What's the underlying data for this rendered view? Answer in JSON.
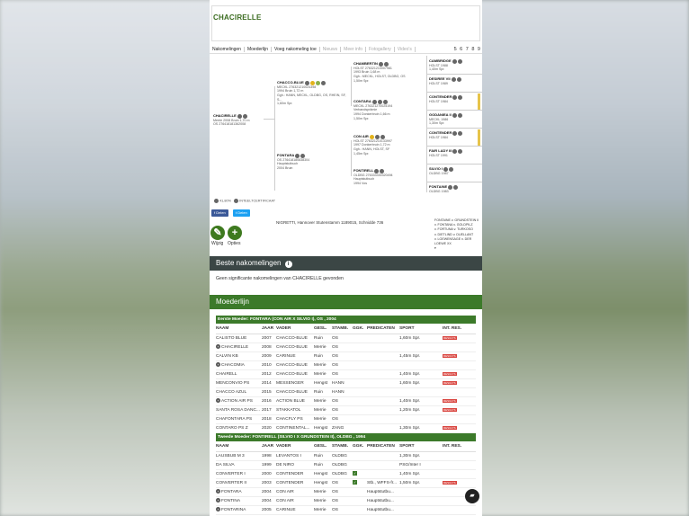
{
  "page": {
    "title": "CHACIRELLE"
  },
  "tabs": [
    {
      "label": "Nakomelingen",
      "muted": false
    },
    {
      "label": "Moederlijn",
      "muted": false
    },
    {
      "label": "Voeg nakomeling toe",
      "muted": false
    },
    {
      "label": "Nieuws",
      "muted": true
    },
    {
      "label": "Meer info",
      "muted": true
    },
    {
      "label": "Fotogallery",
      "muted": true
    },
    {
      "label": "Video's",
      "muted": true
    }
  ],
  "pager": "5 6 7 8 9",
  "pedigree": {
    "horse": {
      "name": "CHACIRELLE",
      "info": "Merrie 2008 Bruin 1,70 m",
      "id": "OS 276418181362008"
    },
    "sire": {
      "name": "CHACCO-BLUE",
      "info": "MECKL 276321210024398",
      "line2": "1994 Bruin 1,72 m",
      "line3": "Ggh.: HANN, MECKL, OLDBG, OS, RHEIN, SF, S...",
      "line4": "1,60m Spr."
    },
    "dam": {
      "name": "FONTARA",
      "info": "OS 276418180838304",
      "line2": "Hauptstutbuch",
      "line3": "2004 Bruin"
    },
    "ss": {
      "name": "CHAMBERTIN",
      "info": "HOLST 276321210007981",
      "line2": "1993 Bruin 1,68 m",
      "line3": "Ggh.: MECKL, HOLST, OLDBG, OS",
      "line4": "1,50m Spr."
    },
    "sd": {
      "name": "CONTARA",
      "info": "MECKL 276321270025194",
      "line2": "Verbandsprämie",
      "line3": "1994 Donkerbruin 1,66 m",
      "line4": "1,50m Spr."
    },
    "ds": {
      "name": "CON AIR",
      "info": "HOLST 276321210133997",
      "line2": "1997 Donkerbruin 1,72 m",
      "line3": "Ggh.: HANN, HOLST, SF",
      "line4": "1,45m Spr."
    },
    "dd": {
      "name": "FONTIRELL",
      "info": "OLDBG 276333330320494",
      "line2": "Hauptstutbuch",
      "line3": "1994 Vos"
    },
    "g4": [
      {
        "name": "CAMBRIDGE",
        "info": "HOLST 1988",
        "extra": "1,40m Spr."
      },
      {
        "name": "DESIREE VII",
        "info": "HOLST 1989",
        "extra": ""
      },
      {
        "name": "CONTENDER",
        "info": "HOLST 1984",
        "extra": ""
      },
      {
        "name": "GODANIEA II",
        "info": "MECKL 1986",
        "extra": "1,30m Spr."
      },
      {
        "name": "CONTENDER",
        "info": "HOLST 1984",
        "extra": ""
      },
      {
        "name": "FAIR LADY III",
        "info": "HOLST 1991",
        "extra": ""
      },
      {
        "name": "SILVIO I",
        "info": "OLDBG 1987",
        "extra": ""
      },
      {
        "name": "FONTAINE",
        "info": "OLDBG 1983",
        "extra": ""
      }
    ],
    "inbreeding": "41,80%",
    "certificate": "INTEELTCERTIFICAAT"
  },
  "share": {
    "facebook": "Delen",
    "twitter": "Delen"
  },
  "stallion_line": "NIGRETTI, Hannover Stutenstamm 1189015, Schnidde 736",
  "damline": [
    "FONTAINE v. GRUNDSTEIN II",
    "v. FONTANA v. GOLDPILZ",
    "v. FORTUNA v. TURKOSO",
    "v. DIETLIND v. DUELLANT",
    "v. LOEWENSAGE v. DER LOEWE XX",
    "▾"
  ],
  "actions": {
    "wijzig": "Wijzig",
    "opties": "Opties"
  },
  "beste": {
    "title": "Beste nakomelingen",
    "text": "Geen significante nakomelingen van CHACIRELLE gevonden"
  },
  "moederlijn": {
    "title": "Moederlijn"
  },
  "first_dam": {
    "title": "Eerste Moeder: FONTARA (CON AIR X SILVIO I), OS , 2004",
    "headers": [
      "NAAM",
      "JAAR",
      "VADER",
      "GESL.",
      "STAMB.",
      "GGK.",
      "PREDICATEN",
      "SPORT",
      "INT. RES."
    ],
    "rows": [
      {
        "plus": false,
        "name": "CALISTO BLUE",
        "year": "2007",
        "father": "CHACCO-BLUE",
        "sex": "Ruin",
        "studbook": "OS",
        "ggk": false,
        "pred": "",
        "sport": "1,60m Spr.",
        "res": "RESULTS"
      },
      {
        "plus": true,
        "name": "CHACIRELLE",
        "year": "2008",
        "father": "CHACCO-BLUE",
        "sex": "Merrie",
        "studbook": "OS",
        "ggk": false,
        "pred": "",
        "sport": "",
        "res": ""
      },
      {
        "plus": false,
        "name": "CALVIN KB",
        "year": "2009",
        "father": "CARINUE",
        "sex": "Ruin",
        "studbook": "OS",
        "ggk": false,
        "pred": "",
        "sport": "1,45m Spr.",
        "res": "RESULTS"
      },
      {
        "plus": true,
        "name": "CHACOMIA",
        "year": "2010",
        "father": "CHACCO-BLUE",
        "sex": "Merrie",
        "studbook": "OS",
        "ggk": false,
        "pred": "",
        "sport": "",
        "res": ""
      },
      {
        "plus": false,
        "name": "CHAIRELL",
        "year": "2012",
        "father": "CHACCO-BLUE",
        "sex": "Merrie",
        "studbook": "OS",
        "ggk": false,
        "pred": "",
        "sport": "1,40m Spr.",
        "res": "RESULTS"
      },
      {
        "plus": false,
        "name": "MENCONVIO PS",
        "year": "2014",
        "father": "MESSENGER",
        "sex": "Hengst",
        "studbook": "HANN",
        "ggk": false,
        "pred": "",
        "sport": "1,60m Spr.",
        "res": "RESULTS"
      },
      {
        "plus": false,
        "name": "CHACCO AZUL",
        "year": "2015",
        "father": "CHACCO-BLUE",
        "sex": "Ruin",
        "studbook": "HANN",
        "ggk": false,
        "pred": "",
        "sport": "",
        "res": ""
      },
      {
        "plus": true,
        "name": "ACTION AIR PS",
        "year": "2016",
        "father": "ACTION BLUE",
        "sex": "Merrie",
        "studbook": "OS",
        "ggk": false,
        "pred": "",
        "sport": "1,40m Spr.",
        "res": "RESULTS"
      },
      {
        "plus": false,
        "name": "SANTA ROSA DANC...",
        "year": "2017",
        "father": "STAKKATOL",
        "sex": "Merrie",
        "studbook": "OS",
        "ggk": false,
        "pred": "",
        "sport": "1,20m Spr.",
        "res": "RESULTS"
      },
      {
        "plus": false,
        "name": "CHAFONTARA PS",
        "year": "2018",
        "father": "CHACFLY PS",
        "sex": "Merrie",
        "studbook": "OS",
        "ggk": false,
        "pred": "",
        "sport": "",
        "res": ""
      },
      {
        "plus": false,
        "name": "CONTARO PS Z",
        "year": "2020",
        "father": "CONTINENTAL...",
        "sex": "Hengst",
        "studbook": "ZANG",
        "ggk": false,
        "pred": "",
        "sport": "1,30m Spr.",
        "res": "RESULTS"
      }
    ]
  },
  "second_dam": {
    "title": "Tweede Moeder: FONTIRELL (SILVIO I X GRUNDSTEIN II), OLDBG , 1994",
    "headers": [
      "NAAM",
      "JAAR",
      "VADER",
      "GESL.",
      "STAMB.",
      "GGK.",
      "PREDICATEN",
      "SPORT",
      "INT. RES."
    ],
    "rows": [
      {
        "plus": false,
        "name": "LAUSBUB M 3",
        "year": "1998",
        "father": "LEVANTOS I",
        "sex": "Ruin",
        "studbook": "OLDBG",
        "ggk": false,
        "pred": "",
        "sport": "1,30m Spr.",
        "res": ""
      },
      {
        "plus": false,
        "name": "DA SILVA",
        "year": "1999",
        "father": "DE NIRO",
        "sex": "Ruin",
        "studbook": "OLDBG",
        "ggk": false,
        "pred": "",
        "sport": "PSG/Inter I",
        "res": ""
      },
      {
        "plus": false,
        "name": "CONVERTER I",
        "year": "2000",
        "father": "CONTENDER",
        "sex": "Hengst",
        "studbook": "OLDBG",
        "ggk": true,
        "pred": "",
        "sport": "1,40m Spr.",
        "res": ""
      },
      {
        "plus": false,
        "name": "CONVERTER II",
        "year": "2003",
        "father": "CONTENDER",
        "sex": "Hengst",
        "studbook": "OS",
        "ggk": true,
        "pred": "Stb., WFFS-fr...",
        "sport": "1,50m Spr.",
        "res": "RESULTS"
      },
      {
        "plus": true,
        "name": "FONTARA",
        "year": "2004",
        "father": "CON AIR",
        "sex": "Merrie",
        "studbook": "OS",
        "ggk": false,
        "pred": "Hauptstutbu...",
        "sport": "",
        "res": ""
      },
      {
        "plus": true,
        "name": "FONTINA",
        "year": "2004",
        "father": "CON AIR",
        "sex": "Merrie",
        "studbook": "OS",
        "ggk": false,
        "pred": "Hauptstutbu...",
        "sport": "",
        "res": ""
      },
      {
        "plus": true,
        "name": "FONTARINA",
        "year": "2005",
        "father": "CARINUE",
        "sex": "Merrie",
        "studbook": "OS",
        "ggk": false,
        "pred": "Hauptstutbu...",
        "sport": "",
        "res": ""
      }
    ]
  },
  "colors": {
    "green": "#3c7a2a",
    "dark": "#3b4645",
    "result_red": "#d9453f"
  }
}
